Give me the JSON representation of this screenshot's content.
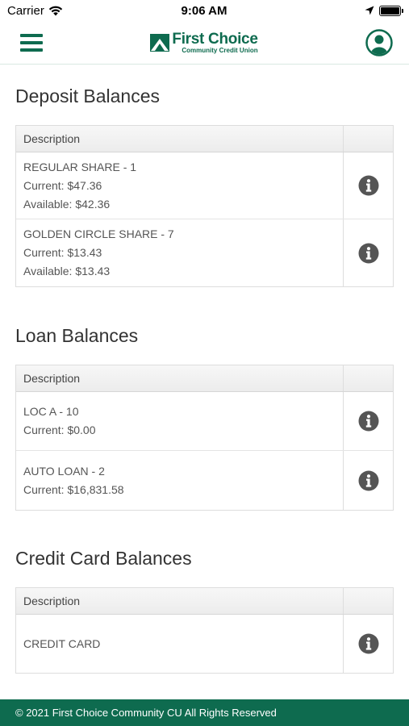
{
  "status_bar": {
    "carrier": "Carrier",
    "time": "9:06 AM"
  },
  "header": {
    "logo_name": "First Choice",
    "logo_sub": "Community Credit Union"
  },
  "sections": {
    "deposit": {
      "title": "Deposit Balances",
      "column_header": "Description",
      "rows": [
        {
          "name": "REGULAR SHARE - 1",
          "current": "Current: $47.36",
          "available": "Available: $42.36"
        },
        {
          "name": "GOLDEN CIRCLE SHARE - 7",
          "current": "Current: $13.43",
          "available": "Available: $13.43"
        }
      ]
    },
    "loan": {
      "title": "Loan Balances",
      "column_header": "Description",
      "rows": [
        {
          "name": "LOC A - 10",
          "current": "Current: $0.00"
        },
        {
          "name": "AUTO LOAN - 2",
          "current": "Current: $16,831.58"
        }
      ]
    },
    "credit": {
      "title": "Credit Card Balances",
      "column_header": "Description",
      "rows": [
        {
          "name": "CREDIT CARD"
        }
      ]
    }
  },
  "footer": {
    "text": "© 2021 First Choice Community CU All Rights Reserved"
  },
  "colors": {
    "brand_green": "#0e6b4f",
    "icon_gray": "#555555"
  }
}
